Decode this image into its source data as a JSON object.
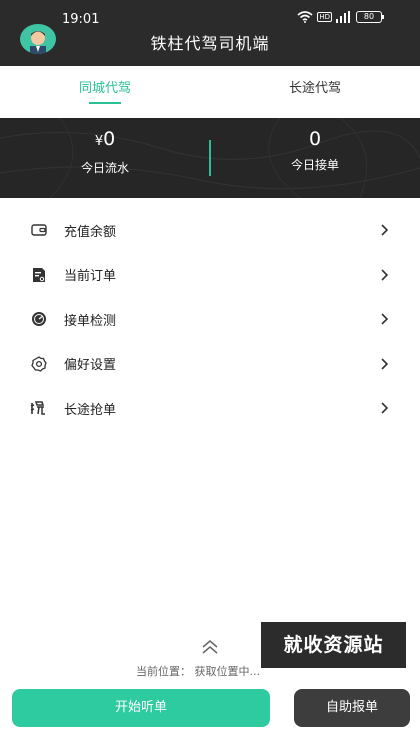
{
  "status_bar": {
    "time": "19:01",
    "battery": "80",
    "network_badge": "HD"
  },
  "header": {
    "title": "铁柱代驾司机端"
  },
  "tabs": [
    {
      "label": "同城代驾",
      "active": true
    },
    {
      "label": "长途代驾",
      "active": false
    }
  ],
  "stats": {
    "flow": {
      "currency": "¥",
      "value": "0",
      "label": "今日流水"
    },
    "orders": {
      "value": "0",
      "label": "今日接单"
    }
  },
  "menu": [
    {
      "label": "充值余额",
      "icon": "wallet-icon"
    },
    {
      "label": "当前订单",
      "icon": "order-icon"
    },
    {
      "label": "接单检测",
      "icon": "detection-icon"
    },
    {
      "label": "偏好设置",
      "icon": "gear-icon"
    },
    {
      "label": "长途抢单",
      "icon": "grab-icon"
    }
  ],
  "location": {
    "text": "当前位置： 获取位置中..."
  },
  "watermark": {
    "text": "就收资源站"
  },
  "actions": {
    "start_label": "开始听单",
    "report_label": "自助报单"
  },
  "colors": {
    "accent": "#2ecba0",
    "dark_bar": "#2b2b2b",
    "stats_bg": "#262626",
    "secondary_button": "#3d3d3d"
  }
}
